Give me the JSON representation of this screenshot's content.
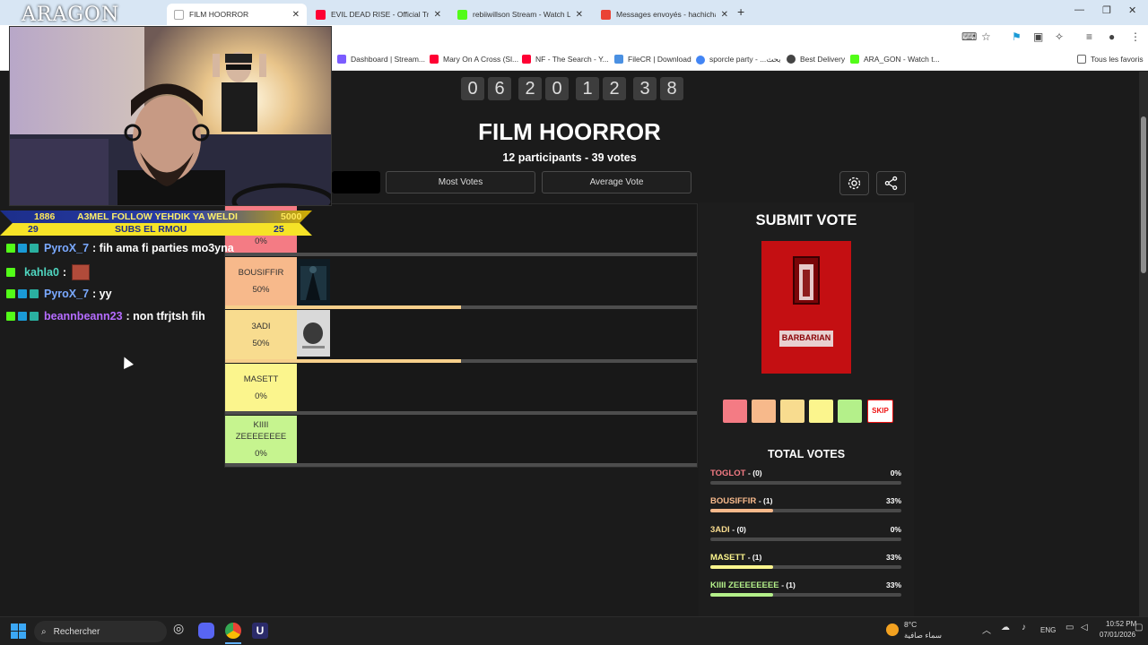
{
  "browser": {
    "tabs": [
      {
        "title": "FILM HOORROR",
        "active": true,
        "color": "#ffffff"
      },
      {
        "title": "EVIL DEAD RISE - Official Trailer",
        "color": "#ff0033"
      },
      {
        "title": "rebiiwillson Stream - Watch Live",
        "color": "#53fc18"
      },
      {
        "title": "Messages envoyés - hachichasli",
        "color": "#ea4335"
      }
    ],
    "bookmarks": [
      {
        "label": "Dashboard | Stream...",
        "color": "#7b5cff"
      },
      {
        "label": "Mary On A Cross (Sl...",
        "color": "#ff0033"
      },
      {
        "label": "NF - The Search - Y...",
        "color": "#ff0033"
      },
      {
        "label": "FileCR | Download",
        "color": "#4a90e2"
      },
      {
        "label": "sporcle party - ...بحث",
        "color": "#4285f4"
      },
      {
        "label": "Best Delivery",
        "color": "#444444"
      },
      {
        "label": "ARA_GON - Watch t...",
        "color": "#53fc18"
      },
      {
        "label": "Tous les favoris",
        "color": "#666666"
      }
    ]
  },
  "page": {
    "timer_digits": [
      "0",
      "6",
      "2",
      "0",
      "1",
      "2",
      "3",
      "8"
    ],
    "title": "FILM HOORROR",
    "subtitle": "12 participants - 39 votes",
    "buttons": {
      "most_votes": "Most Votes",
      "average_vote": "Average Vote"
    },
    "tiers": [
      {
        "name": "BOUSIFFIR",
        "pct": "50%",
        "fill": 0.5,
        "color": "#f7b98b"
      },
      {
        "name": "3ADI",
        "pct": "50%",
        "fill": 0.5,
        "color": "#f8dc8f"
      },
      {
        "name": "MASETT",
        "pct": "0%",
        "fill": 0,
        "color": "#fbf58d"
      },
      {
        "name": "KIIII ZEEEEEEEE",
        "pct": "0%",
        "fill": 0,
        "color": "#c6f48f"
      }
    ],
    "partial_tier_pct": "0%",
    "submit_title": "SUBMIT VOTE",
    "poster_title": "BARBARIAN",
    "swatches": [
      "#f47b84",
      "#f7b98b",
      "#f8dc8f",
      "#fbf58d",
      "#b4f08a"
    ],
    "skip_label": "SKIP",
    "total_votes_title": "TOTAL VOTES",
    "total_votes": [
      {
        "name": "TOGLOT",
        "count": "- (0)",
        "pct": "0%",
        "fill": 0,
        "color": "#f47b84"
      },
      {
        "name": "BOUSIFFIR",
        "count": "- (1)",
        "pct": "33%",
        "fill": 0.33,
        "color": "#f7b98b"
      },
      {
        "name": "3ADI",
        "count": "- (0)",
        "pct": "0%",
        "fill": 0,
        "color": "#f8dc8f"
      },
      {
        "name": "MASETT",
        "count": "- (1)",
        "pct": "33%",
        "fill": 0.33,
        "color": "#fbf58d"
      },
      {
        "name": "KIIII ZEEEEEEEE",
        "count": "- (1)",
        "pct": "33%",
        "fill": 0.33,
        "color": "#b4f08a"
      }
    ]
  },
  "stream": {
    "logo": "ARAGON",
    "goal_follow": {
      "current": "1886",
      "label": "A3MEL FOLLOW YEHDIK YA WELDI",
      "target": "5000"
    },
    "goal_subs": {
      "current": "29",
      "label": "SUBS EL RMOU",
      "target": "25"
    },
    "chat": [
      {
        "user": "PyroX_7",
        "user_color": "#7aa9ff",
        "text": ": fih ama fi parties mo3yna"
      },
      {
        "user": "kahla0",
        "user_color": "#4fd6c0",
        "text": ":"
      },
      {
        "user": "PyroX_7",
        "user_color": "#7aa9ff",
        "text": ": yy"
      },
      {
        "user": "beannbeann23",
        "user_color": "#b56cff",
        "text": ": non tfrjtsh fih"
      }
    ]
  },
  "taskbar": {
    "search_placeholder": "Rechercher",
    "weather_temp": "8°C",
    "weather_desc": "سماء صافية",
    "lang": "ENG",
    "time": "10:52 PM",
    "date": "07/01/2026"
  }
}
